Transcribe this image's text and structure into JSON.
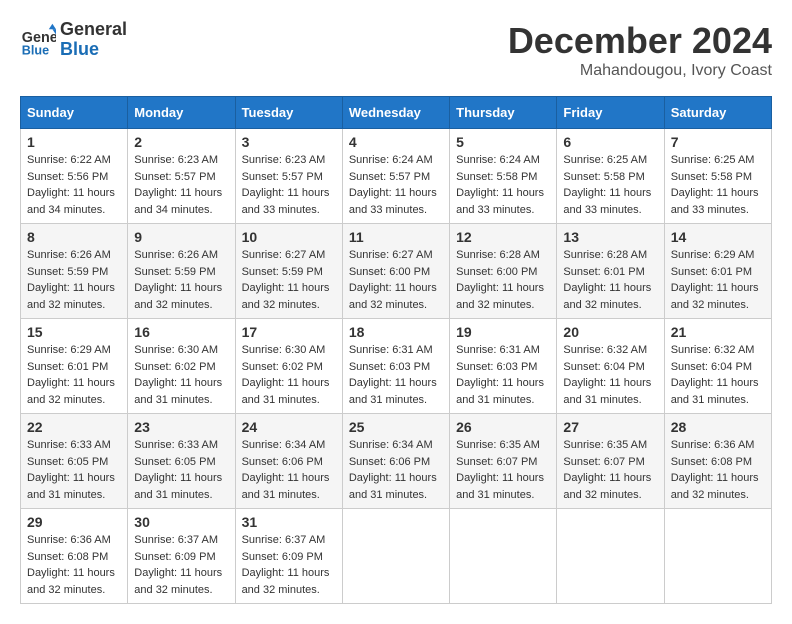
{
  "header": {
    "logo_line1": "General",
    "logo_line2": "Blue",
    "month": "December 2024",
    "location": "Mahandougou, Ivory Coast"
  },
  "weekdays": [
    "Sunday",
    "Monday",
    "Tuesday",
    "Wednesday",
    "Thursday",
    "Friday",
    "Saturday"
  ],
  "weeks": [
    [
      {
        "day": "1",
        "sunrise": "6:22 AM",
        "sunset": "5:56 PM",
        "daylight": "11 hours and 34 minutes."
      },
      {
        "day": "2",
        "sunrise": "6:23 AM",
        "sunset": "5:57 PM",
        "daylight": "11 hours and 34 minutes."
      },
      {
        "day": "3",
        "sunrise": "6:23 AM",
        "sunset": "5:57 PM",
        "daylight": "11 hours and 33 minutes."
      },
      {
        "day": "4",
        "sunrise": "6:24 AM",
        "sunset": "5:57 PM",
        "daylight": "11 hours and 33 minutes."
      },
      {
        "day": "5",
        "sunrise": "6:24 AM",
        "sunset": "5:58 PM",
        "daylight": "11 hours and 33 minutes."
      },
      {
        "day": "6",
        "sunrise": "6:25 AM",
        "sunset": "5:58 PM",
        "daylight": "11 hours and 33 minutes."
      },
      {
        "day": "7",
        "sunrise": "6:25 AM",
        "sunset": "5:58 PM",
        "daylight": "11 hours and 33 minutes."
      }
    ],
    [
      {
        "day": "8",
        "sunrise": "6:26 AM",
        "sunset": "5:59 PM",
        "daylight": "11 hours and 32 minutes."
      },
      {
        "day": "9",
        "sunrise": "6:26 AM",
        "sunset": "5:59 PM",
        "daylight": "11 hours and 32 minutes."
      },
      {
        "day": "10",
        "sunrise": "6:27 AM",
        "sunset": "5:59 PM",
        "daylight": "11 hours and 32 minutes."
      },
      {
        "day": "11",
        "sunrise": "6:27 AM",
        "sunset": "6:00 PM",
        "daylight": "11 hours and 32 minutes."
      },
      {
        "day": "12",
        "sunrise": "6:28 AM",
        "sunset": "6:00 PM",
        "daylight": "11 hours and 32 minutes."
      },
      {
        "day": "13",
        "sunrise": "6:28 AM",
        "sunset": "6:01 PM",
        "daylight": "11 hours and 32 minutes."
      },
      {
        "day": "14",
        "sunrise": "6:29 AM",
        "sunset": "6:01 PM",
        "daylight": "11 hours and 32 minutes."
      }
    ],
    [
      {
        "day": "15",
        "sunrise": "6:29 AM",
        "sunset": "6:01 PM",
        "daylight": "11 hours and 32 minutes."
      },
      {
        "day": "16",
        "sunrise": "6:30 AM",
        "sunset": "6:02 PM",
        "daylight": "11 hours and 31 minutes."
      },
      {
        "day": "17",
        "sunrise": "6:30 AM",
        "sunset": "6:02 PM",
        "daylight": "11 hours and 31 minutes."
      },
      {
        "day": "18",
        "sunrise": "6:31 AM",
        "sunset": "6:03 PM",
        "daylight": "11 hours and 31 minutes."
      },
      {
        "day": "19",
        "sunrise": "6:31 AM",
        "sunset": "6:03 PM",
        "daylight": "11 hours and 31 minutes."
      },
      {
        "day": "20",
        "sunrise": "6:32 AM",
        "sunset": "6:04 PM",
        "daylight": "11 hours and 31 minutes."
      },
      {
        "day": "21",
        "sunrise": "6:32 AM",
        "sunset": "6:04 PM",
        "daylight": "11 hours and 31 minutes."
      }
    ],
    [
      {
        "day": "22",
        "sunrise": "6:33 AM",
        "sunset": "6:05 PM",
        "daylight": "11 hours and 31 minutes."
      },
      {
        "day": "23",
        "sunrise": "6:33 AM",
        "sunset": "6:05 PM",
        "daylight": "11 hours and 31 minutes."
      },
      {
        "day": "24",
        "sunrise": "6:34 AM",
        "sunset": "6:06 PM",
        "daylight": "11 hours and 31 minutes."
      },
      {
        "day": "25",
        "sunrise": "6:34 AM",
        "sunset": "6:06 PM",
        "daylight": "11 hours and 31 minutes."
      },
      {
        "day": "26",
        "sunrise": "6:35 AM",
        "sunset": "6:07 PM",
        "daylight": "11 hours and 31 minutes."
      },
      {
        "day": "27",
        "sunrise": "6:35 AM",
        "sunset": "6:07 PM",
        "daylight": "11 hours and 32 minutes."
      },
      {
        "day": "28",
        "sunrise": "6:36 AM",
        "sunset": "6:08 PM",
        "daylight": "11 hours and 32 minutes."
      }
    ],
    [
      {
        "day": "29",
        "sunrise": "6:36 AM",
        "sunset": "6:08 PM",
        "daylight": "11 hours and 32 minutes."
      },
      {
        "day": "30",
        "sunrise": "6:37 AM",
        "sunset": "6:09 PM",
        "daylight": "11 hours and 32 minutes."
      },
      {
        "day": "31",
        "sunrise": "6:37 AM",
        "sunset": "6:09 PM",
        "daylight": "11 hours and 32 minutes."
      },
      null,
      null,
      null,
      null
    ]
  ]
}
